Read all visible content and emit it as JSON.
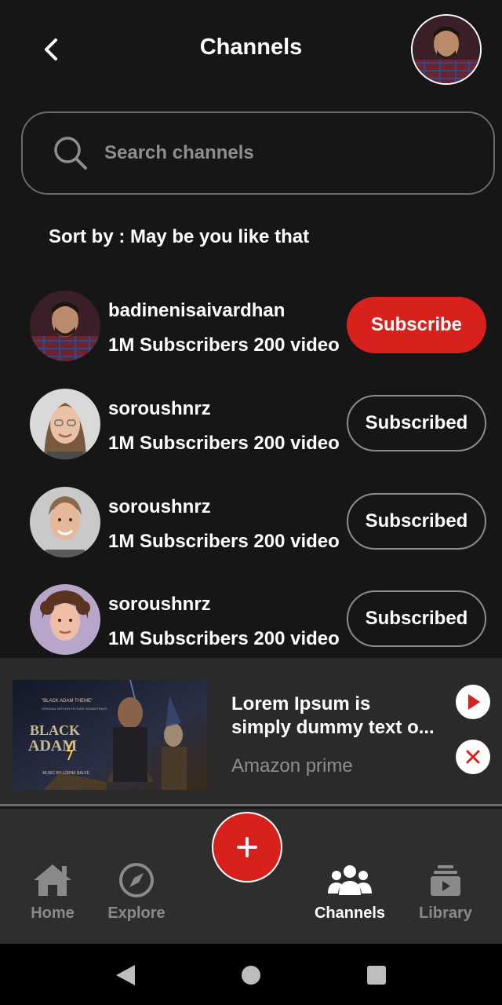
{
  "header": {
    "title": "Channels"
  },
  "search": {
    "placeholder": "Search channels"
  },
  "sort": {
    "label": "Sort by : May be you like that"
  },
  "channels": [
    {
      "name": "badinenisaivardhan",
      "meta": "1M Subscribers 200 video",
      "button": "Subscribe"
    },
    {
      "name": "soroushnrz",
      "meta": "1M Subscribers 200 video",
      "button": "Subscribed"
    },
    {
      "name": "soroushnrz",
      "meta": "1M Subscribers 200 video",
      "button": "Subscribed"
    },
    {
      "name": "soroushnrz",
      "meta": "1M Subscribers 200 video",
      "button": "Subscribed"
    }
  ],
  "mini_player": {
    "title_line1": "Lorem Ipsum is",
    "title_line2": "simply dummy text o...",
    "subtitle": "Amazon prime",
    "thumbnail": {
      "tag_line": "\"BLACK ADAM THEME\"",
      "tag_line2": "ORIGINAL MOTION PICTURE SOUNDTRACK",
      "title_line1": "BLACK",
      "title_line2": "ADAM",
      "credit": "MUSIC BY LORNE BALFE"
    }
  },
  "nav": {
    "home": "Home",
    "explore": "Explore",
    "channels": "Channels",
    "library": "Library"
  },
  "colors": {
    "accent": "#d8201d",
    "background": "#161616",
    "muted": "#8a8a8a"
  }
}
